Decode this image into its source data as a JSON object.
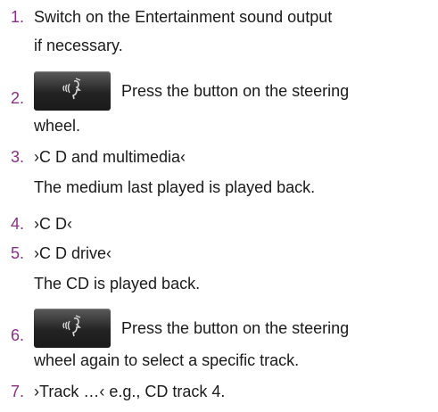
{
  "colors": {
    "accent": "#8c2f86",
    "text": "#1a1a1a"
  },
  "steps": [
    {
      "num": "1.",
      "lines": [
        "Switch on the Entertainment sound output",
        "if necessary."
      ]
    },
    {
      "num": "2.",
      "icon": "voice-control-button-icon",
      "lines": [
        "Press the button on the steering",
        "wheel."
      ]
    },
    {
      "num": "3.",
      "lines": [
        "›C D and multimedia‹"
      ],
      "note": "The medium last played is played back."
    },
    {
      "num": "4.",
      "lines": [
        "›C D‹"
      ]
    },
    {
      "num": "5.",
      "lines": [
        "›C D drive‹"
      ],
      "note": "The CD is played back."
    },
    {
      "num": "6.",
      "icon": "voice-control-button-icon",
      "lines": [
        "Press the button on the steering",
        "wheel again to select a specific track."
      ]
    },
    {
      "num": "7.",
      "lines": [
        "›Track …‹ e.g., CD track 4."
      ]
    }
  ]
}
